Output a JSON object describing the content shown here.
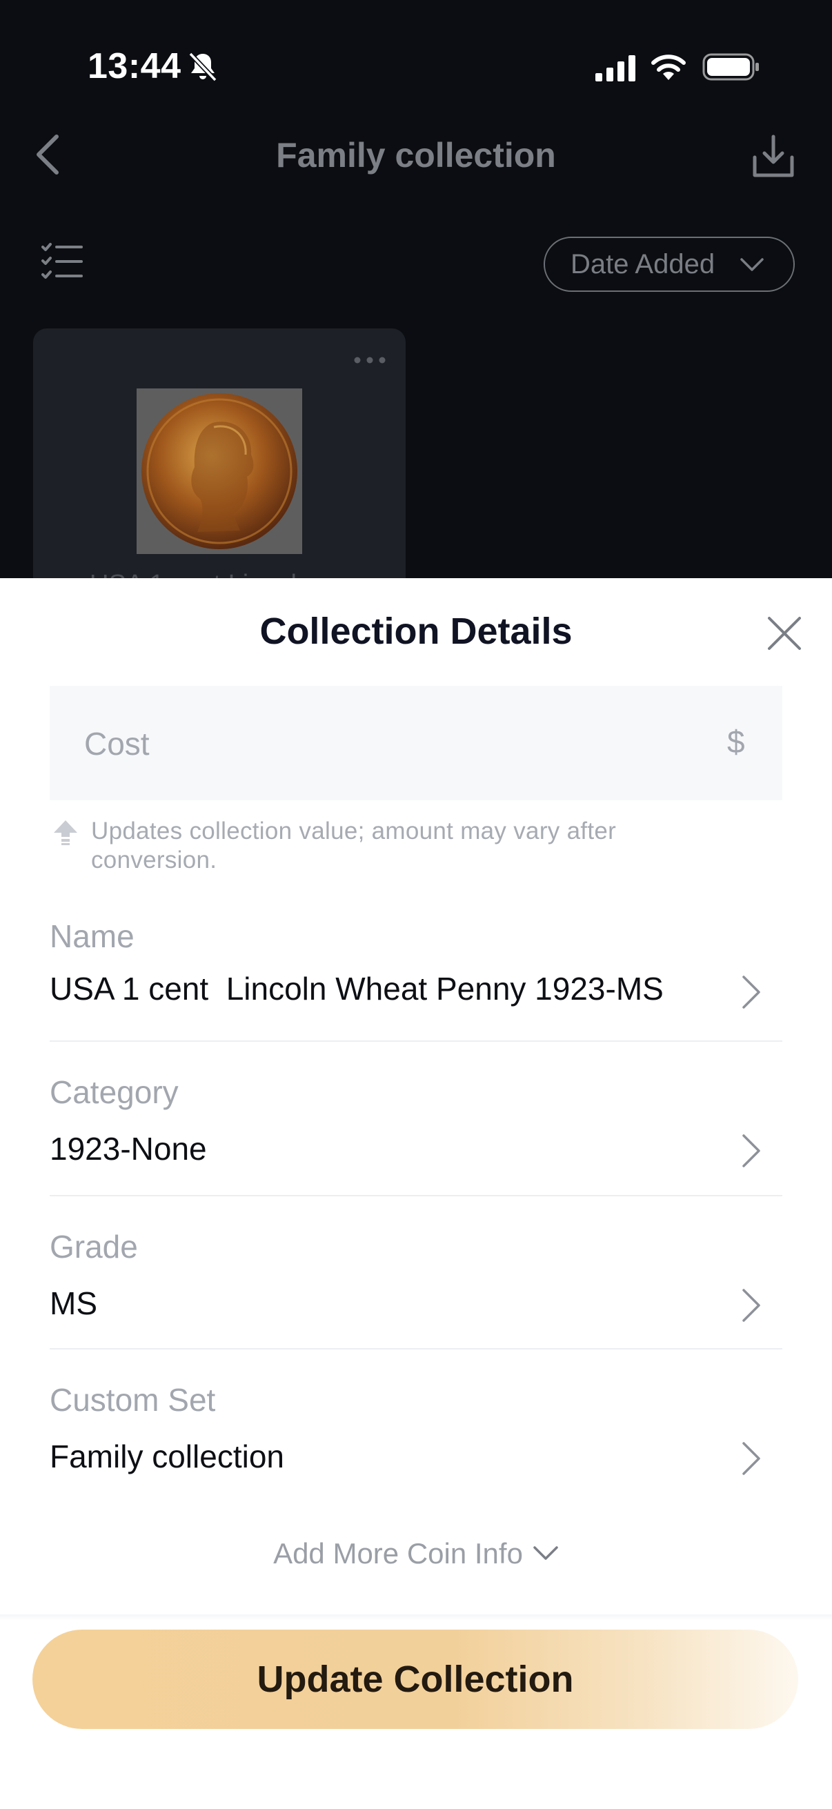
{
  "status_bar": {
    "time": "13:44",
    "icons": [
      "bell-off-icon",
      "signal-icon",
      "wifi-icon",
      "battery-icon"
    ]
  },
  "nav": {
    "title": "Family collection",
    "back_icon": "back-icon",
    "action_icon": "download-icon"
  },
  "toolbar": {
    "filter_icon": "list-icon",
    "sort_label": "Date Added"
  },
  "coin_card": {
    "title_peek": "USA 1 cent Lincol..."
  },
  "sheet": {
    "title": "Collection Details",
    "cost": {
      "placeholder": "Cost",
      "value": "",
      "currency": "$"
    },
    "hint": "Updates collection value; amount may vary after conversion.",
    "fields": [
      {
        "label": "Name",
        "value": "USA 1 cent  Lincoln Wheat Penny 1923-MS"
      },
      {
        "label": "Category",
        "value": "1923-None"
      },
      {
        "label": "Grade",
        "value": "MS"
      },
      {
        "label": "Custom Set",
        "value": "Family collection"
      }
    ],
    "add_more": "Add More Coin Info",
    "submit": "Update Collection"
  },
  "colors": {
    "sheet_bg": "#ffffff",
    "accent_gold": "#f4d199",
    "title_text": "#101323",
    "muted_text": "#a2a6ae"
  }
}
